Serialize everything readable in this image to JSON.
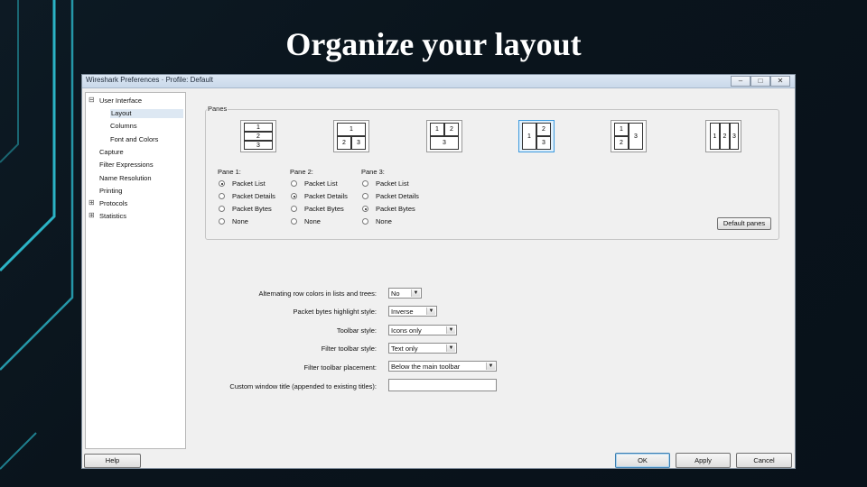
{
  "slide": {
    "title": "Organize your layout"
  },
  "window": {
    "title": "Wireshark Preferences · Profile: Default",
    "controls": {
      "minimize": "–",
      "maximize": "□",
      "close": "✕"
    }
  },
  "tree": {
    "items": [
      {
        "label": "User Interface",
        "toggle": "⊟"
      },
      {
        "label": "Layout",
        "selected": true
      },
      {
        "label": "Columns"
      },
      {
        "label": "Font and Colors"
      },
      {
        "label": "Capture"
      },
      {
        "label": "Filter Expressions"
      },
      {
        "label": "Name Resolution"
      },
      {
        "label": "Printing"
      },
      {
        "label": "Protocols",
        "toggle": "⊞"
      },
      {
        "label": "Statistics",
        "toggle": "⊞"
      }
    ]
  },
  "panes": {
    "group_label": "Panes",
    "layout_options": [
      {
        "cells": [
          "1",
          "2",
          "3"
        ]
      },
      {
        "cells": [
          "1",
          "2",
          "3"
        ]
      },
      {
        "cells": [
          "1",
          "2",
          "3"
        ]
      },
      {
        "cells": [
          "1",
          "2",
          "3"
        ],
        "selected": true
      },
      {
        "cells": [
          "1",
          "2",
          "3"
        ]
      },
      {
        "cells": [
          "1",
          "2",
          "3"
        ]
      }
    ],
    "columns": [
      {
        "label": "Pane 1:",
        "options": [
          "Packet List",
          "Packet Details",
          "Packet Bytes",
          "None"
        ],
        "selected": 0
      },
      {
        "label": "Pane 2:",
        "options": [
          "Packet List",
          "Packet Details",
          "Packet Bytes",
          "None"
        ],
        "selected": 1
      },
      {
        "label": "Pane 3:",
        "options": [
          "Packet List",
          "Packet Details",
          "Packet Bytes",
          "None"
        ],
        "selected": 2
      }
    ],
    "default_button": "Default panes"
  },
  "settings": {
    "alternating": {
      "label": "Alternating row colors in lists and trees:",
      "value": "No"
    },
    "highlight": {
      "label": "Packet bytes highlight style:",
      "value": "Inverse"
    },
    "toolbar": {
      "label": "Toolbar style:",
      "value": "Icons only"
    },
    "filter_toolbar": {
      "label": "Filter toolbar style:",
      "value": "Text only"
    },
    "filter_placement": {
      "label": "Filter toolbar placement:",
      "value": "Below the main toolbar"
    },
    "custom_title": {
      "label": "Custom window title (appended to existing titles):",
      "value": ""
    }
  },
  "buttons": {
    "help": "Help",
    "ok": "OK",
    "apply": "Apply",
    "cancel": "Cancel"
  },
  "colors": {
    "selection": "#3c9ade",
    "background": "#0a141c"
  }
}
